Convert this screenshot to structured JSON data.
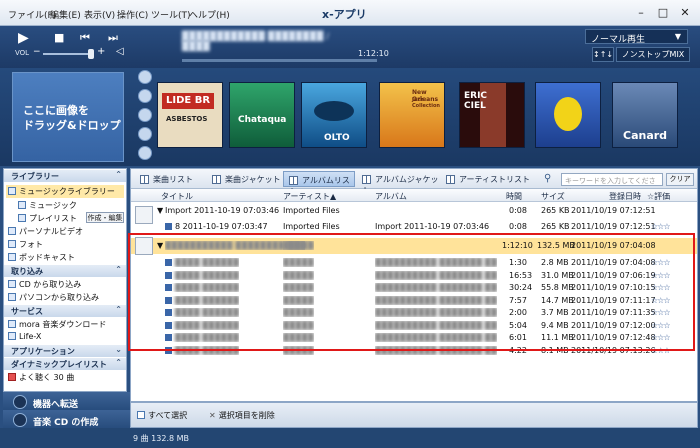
{
  "window": {
    "title": "x-アプリ",
    "menus": [
      "ファイル(F)",
      "編集(E)",
      "表示(V)",
      "操作(C)",
      "ツール(T)",
      "ヘルプ(H)"
    ]
  },
  "player": {
    "now_playing": "",
    "elapsed": "1:12:10",
    "volume_label": "VOL",
    "volume_pct": 100,
    "mode": "ノーマル再生",
    "shuffle_label": "↕↑↓",
    "nonstop_label": "ノンストップMIX"
  },
  "visual": {
    "drop_text_1": "ここに画像を",
    "drop_text_2": "ドラッグ&ドロップ",
    "jackets": [
      {
        "name": "LIDE BR ASBESTOS",
        "bg": "#c22b22",
        "t1": "LIDE BR",
        "t2": "ASBESTOS"
      },
      {
        "name": "Chataquera",
        "bg": "#1f8f5a",
        "t1": "Chataqua",
        "t2": ""
      },
      {
        "name": "OLTO",
        "bg": "#1d6fa8",
        "t1": "OLTO",
        "t2": ""
      },
      {
        "name": "New Orleans Jazz Collection",
        "bg": "#e29a18",
        "t1": "New Orleans",
        "t2": "Jazz Collection"
      },
      {
        "name": "ERIC CIEL",
        "bg": "#5a1212",
        "t1": "ERIC",
        "t2": "CIEL"
      },
      {
        "name": "Flowers",
        "bg": "#2e56b8",
        "t1": "",
        "t2": ""
      },
      {
        "name": "Canard",
        "bg": "#3e5f8f",
        "t1": "Canard",
        "t2": ""
      }
    ]
  },
  "sidebar": {
    "sections": [
      {
        "title": "ライブラリー"
      },
      {
        "title": "取り込み"
      },
      {
        "title": "サービス"
      },
      {
        "title": "アプリケーション"
      },
      {
        "title": "ダイナミックプレイリスト"
      }
    ],
    "library_items": [
      "ミュージックライブラリー",
      "ミュージック",
      "プレイリスト",
      "パーソナルビデオ",
      "フォト",
      "ポッドキャスト"
    ],
    "edit_label": "作成・編集",
    "import_items": [
      "CD から取り込み",
      "パソコンから取り込み"
    ],
    "service_items": [
      "mora 音楽ダウンロード",
      "Life-X"
    ],
    "dynamic_items": [
      "よく聴く 30 曲"
    ],
    "transfer_label": "機器へ転送",
    "cd_label": "音楽 CD の作成"
  },
  "tabs": [
    "楽曲リスト",
    "楽曲ジャケット",
    "アルバムリスト",
    "アルバムジャケット",
    "アーティストリスト"
  ],
  "search_placeholder": "キーワードを入力してください",
  "clear_label": "クリア",
  "columns": [
    "タイトル",
    "アーティスト▲",
    "アルバム",
    "時間",
    "サイズ",
    "登録日時",
    "☆評価"
  ],
  "group1": {
    "title": "Import 2011-10-19 07:03:46",
    "artist": "Imported Files",
    "time": "0:08",
    "size": "265 KB",
    "date": "2011/10/19 07:12:51"
  },
  "group1_track": {
    "title": "8  2011-10-19 07:03:47",
    "artist": "Imported Files",
    "album": "Import 2011-10-19 07:03:46",
    "time": "0:08",
    "size": "265 KB",
    "date": "2011/10/19 07:12:51"
  },
  "group2": {
    "title": "",
    "artist": "",
    "time": "1:12:10",
    "size": "132.5 MB",
    "date": "2011/10/19 07:04:08"
  },
  "tracks": [
    {
      "time": "1:30",
      "size": "2.8 MB",
      "date": "2011/10/19 07:04:08"
    },
    {
      "time": "16:53",
      "size": "31.0 MB",
      "date": "2011/10/19 07:06:19"
    },
    {
      "time": "30:24",
      "size": "55.8 MB",
      "date": "2011/10/19 07:10:15"
    },
    {
      "time": "7:57",
      "size": "14.7 MB",
      "date": "2011/10/19 07:11:17"
    },
    {
      "time": "2:00",
      "size": "3.7 MB",
      "date": "2011/10/19 07:11:35"
    },
    {
      "time": "5:04",
      "size": "9.4 MB",
      "date": "2011/10/19 07:12:00"
    },
    {
      "time": "6:01",
      "size": "11.1 MB",
      "date": "2011/10/19 07:12:48"
    },
    {
      "time": "4:22",
      "size": "8.1 MB",
      "date": "2011/10/19 07:13:26"
    }
  ],
  "stars": "☆☆☆",
  "bottom": {
    "select_all": "すべて選択",
    "delete_selected": "選択項目を削除"
  },
  "status": "9 曲 132.8 MB"
}
